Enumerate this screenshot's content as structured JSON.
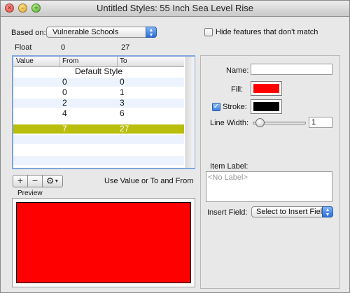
{
  "window": {
    "title": "Untitled Styles: 55 Inch Sea Level Rise"
  },
  "header": {
    "based_on_label": "Based on:",
    "based_on_value": "Vulnerable Schools",
    "hide_features_label": "Hide features that don't match",
    "hide_features_checked": false,
    "field_type": "Float",
    "range_min": "0",
    "range_max": "27"
  },
  "table": {
    "columns": [
      "Value",
      "From",
      "To"
    ],
    "default_row": "Default Style",
    "rows": [
      {
        "value": "0",
        "from": "0"
      },
      {
        "value": "0",
        "from": "1"
      },
      {
        "value": "2",
        "from": "3"
      },
      {
        "value": "4",
        "from": "6"
      },
      {
        "value": "7",
        "from": "27",
        "selected": true
      }
    ]
  },
  "toolbar": {
    "add_label": "+",
    "remove_label": "−",
    "gear_icon": "gear-icon",
    "mode_text": "Use Value or To and From"
  },
  "preview": {
    "label": "Preview",
    "fill_color": "#ff0000"
  },
  "style_panel": {
    "name_label": "Name:",
    "name_value": "",
    "fill_label": "Fill:",
    "fill_color": "#ff0000",
    "stroke_label": "Stroke:",
    "stroke_checked": true,
    "stroke_color": "#000000",
    "line_width_label": "Line Width:",
    "line_width_value": "1",
    "item_label_label": "Item Label:",
    "item_label_placeholder": "<No Label>",
    "insert_field_label": "Insert Field:",
    "insert_field_value": "Select to Insert Field"
  }
}
